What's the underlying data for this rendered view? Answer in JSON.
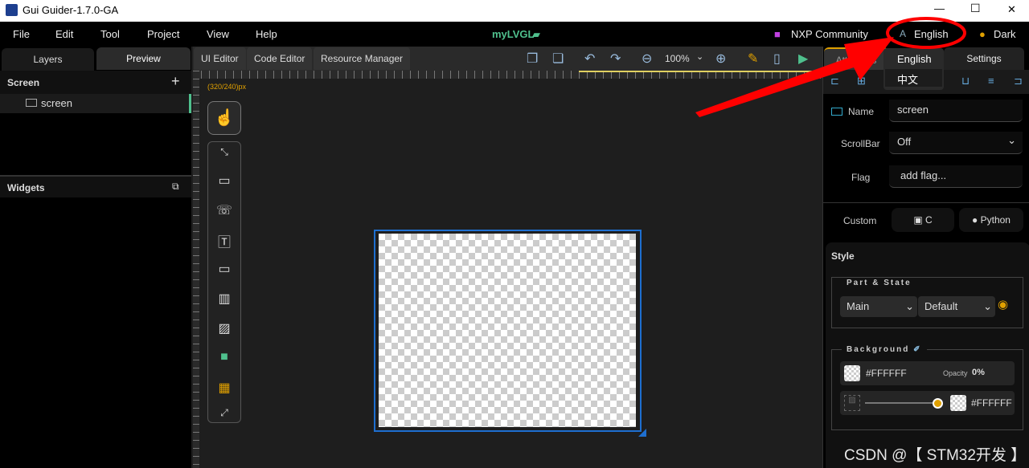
{
  "window": {
    "title": "Gui Guider-1.7.0-GA",
    "minimize": "—",
    "maximize": "☐",
    "close": "✕"
  },
  "menu": {
    "items": [
      "File",
      "Edit",
      "Tool",
      "Project",
      "View",
      "Help"
    ],
    "project": "myLVGL",
    "community": "NXP Community",
    "language": "English",
    "theme": "Dark"
  },
  "left": {
    "tabs": [
      "Layers",
      "Preview"
    ],
    "screen_header": "Screen",
    "add": "+",
    "screen_item": "screen",
    "widgets_header": "Widgets"
  },
  "center": {
    "tabs": [
      "UI Editor",
      "Code Editor",
      "Resource Manager"
    ],
    "zoom": "100%",
    "resolution": "(320/240)px"
  },
  "lang_dropdown": {
    "options": [
      "English",
      "中文"
    ],
    "selected": "English"
  },
  "right": {
    "tabs": [
      "Attributes",
      "Settings"
    ],
    "name_label": "Name",
    "name_value": "screen",
    "scrollbar_label": "ScrollBar",
    "scrollbar_value": "Off",
    "flag_label": "Flag",
    "flag_placeholder": "add flag...",
    "custom_label": "Custom",
    "custom_c": "C",
    "custom_python": "Python",
    "style_header": "Style",
    "part_state": "Part & State",
    "part": "Main",
    "state": "Default",
    "background": "Background",
    "bg_color": "#FFFFFF",
    "opacity_label": "Opacity",
    "opacity_value": "0%",
    "grad_color": "#FFFFFF"
  },
  "watermark": "CSDN @【 STM32开发 】",
  "colors": {
    "accent_green": "#4fc08d",
    "selection_blue": "#1e6fd0",
    "annotation_red": "#ff0000",
    "orange": "#e0a000"
  }
}
